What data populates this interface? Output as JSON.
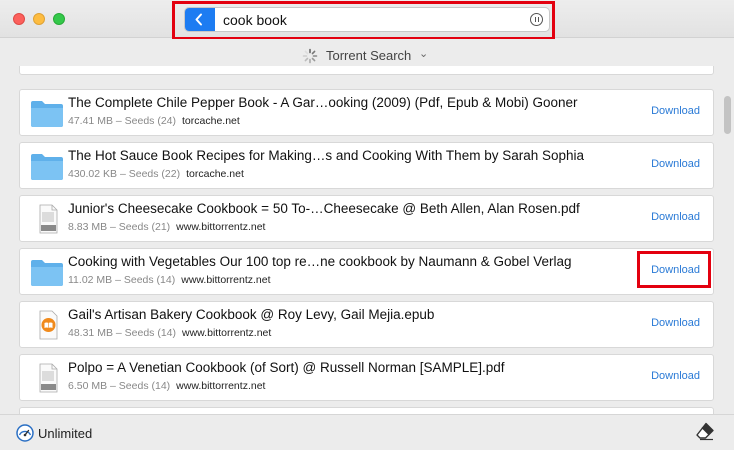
{
  "search": {
    "value": "cook book"
  },
  "source": {
    "label": "Torrent Search"
  },
  "rows": [
    {
      "title": "",
      "size": "",
      "seeds": "",
      "source": "",
      "icon": "folder-icon",
      "download": ""
    },
    {
      "title": "The Complete Chile Pepper Book - A Gar…ooking (2009) (Pdf, Epub & Mobi) Gooner",
      "size": "47.41 MB",
      "seeds": "Seeds (24)",
      "source": "torcache.net",
      "icon": "folder-icon",
      "download": "Download"
    },
    {
      "title": "The Hot Sauce Book Recipes for Making…s and Cooking With Them by Sarah Sophia",
      "size": "430.02 KB",
      "seeds": "Seeds (22)",
      "source": "torcache.net",
      "icon": "folder-icon",
      "download": "Download"
    },
    {
      "title": "Junior's Cheesecake Cookbook = 50 To-…Cheesecake @ Beth Allen, Alan Rosen.pdf",
      "size": "8.83 MB",
      "seeds": "Seeds (21)",
      "source": "www.bittorrentz.net",
      "icon": "pdf-file-icon",
      "download": "Download"
    },
    {
      "title": "Cooking with Vegetables Our 100 top re…ne cookbook by Naumann & Gobel Verlag",
      "size": "11.02 MB",
      "seeds": "Seeds (14)",
      "source": "www.bittorrentz.net",
      "icon": "folder-icon",
      "download": "Download"
    },
    {
      "title": "Gail's Artisan Bakery Cookbook @ Roy Levy, Gail Mejia.epub",
      "size": "48.31 MB",
      "seeds": "Seeds (14)",
      "source": "www.bittorrentz.net",
      "icon": "ibooks-file-icon",
      "download": "Download"
    },
    {
      "title": "Polpo = A Venetian Cookbook (of Sort) @ Russell Norman [SAMPLE].pdf",
      "size": "6.50 MB",
      "seeds": "Seeds (14)",
      "source": "www.bittorrentz.net",
      "icon": "pdf-file-icon",
      "download": "Download"
    },
    {
      "title": "",
      "size": "",
      "seeds": "",
      "source": "",
      "icon": "folder-icon",
      "download": ""
    }
  ],
  "footer": {
    "speed_label": "Unlimited"
  },
  "colors": {
    "accent": "#1d7cf2",
    "link": "#2a7ad6",
    "highlight": "#e3000f"
  }
}
